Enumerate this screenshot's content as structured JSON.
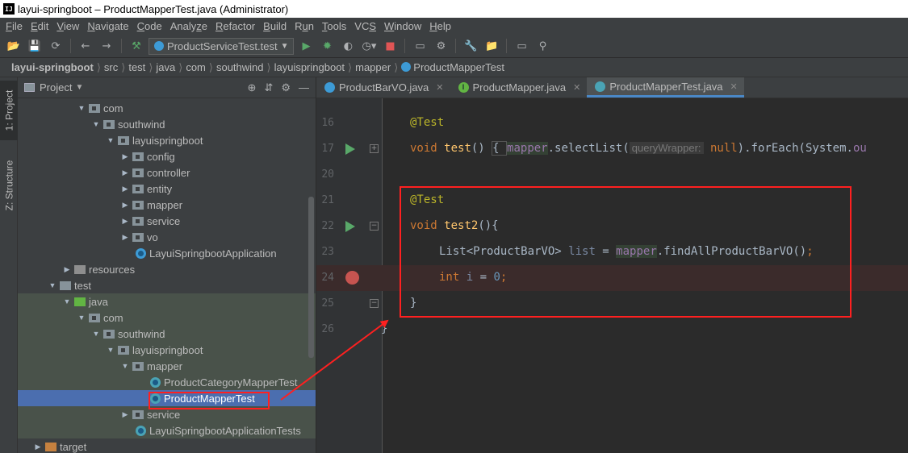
{
  "window": {
    "title": "layui-springboot – ProductMapperTest.java (Administrator)",
    "app_icon": "IJ"
  },
  "menu": {
    "items": [
      {
        "pre": "",
        "u": "F",
        "post": "ile"
      },
      {
        "pre": "",
        "u": "E",
        "post": "dit"
      },
      {
        "pre": "",
        "u": "V",
        "post": "iew"
      },
      {
        "pre": "",
        "u": "N",
        "post": "avigate"
      },
      {
        "pre": "",
        "u": "C",
        "post": "ode"
      },
      {
        "pre": "Analy",
        "u": "z",
        "post": "e"
      },
      {
        "pre": "",
        "u": "R",
        "post": "efactor"
      },
      {
        "pre": "",
        "u": "B",
        "post": "uild"
      },
      {
        "pre": "R",
        "u": "u",
        "post": "n"
      },
      {
        "pre": "",
        "u": "T",
        "post": "ools"
      },
      {
        "pre": "VC",
        "u": "S",
        "post": ""
      },
      {
        "pre": "",
        "u": "W",
        "post": "indow"
      },
      {
        "pre": "",
        "u": "H",
        "post": "elp"
      }
    ]
  },
  "toolbar": {
    "run_config": "ProductServiceTest.test"
  },
  "breadcrumb": {
    "items": [
      "layui-springboot",
      "src",
      "test",
      "java",
      "com",
      "southwind",
      "layuispringboot",
      "mapper",
      "ProductMapperTest"
    ]
  },
  "toolstrip": {
    "project_tab": "1: Project",
    "structure_tab": "Z: Structure"
  },
  "project_panel": {
    "title": "Project",
    "tree": [
      {
        "label": "com"
      },
      {
        "label": "southwind"
      },
      {
        "label": "layuispringboot"
      },
      {
        "label": "config"
      },
      {
        "label": "controller"
      },
      {
        "label": "entity"
      },
      {
        "label": "mapper"
      },
      {
        "label": "service"
      },
      {
        "label": "vo"
      },
      {
        "label": "LayuiSpringbootApplication"
      },
      {
        "label": "resources"
      },
      {
        "label": "test"
      },
      {
        "label": "java"
      },
      {
        "label": "com"
      },
      {
        "label": "southwind"
      },
      {
        "label": "layuispringboot"
      },
      {
        "label": "mapper"
      },
      {
        "label": "ProductCategoryMapperTest"
      },
      {
        "label": "ProductMapperTest"
      },
      {
        "label": "service"
      },
      {
        "label": "LayuiSpringbootApplicationTests"
      },
      {
        "label": "target"
      }
    ]
  },
  "editor": {
    "tabs": [
      {
        "label": "ProductBarVO.java",
        "icon": "class-icon"
      },
      {
        "label": "ProductMapper.java",
        "icon": "interface-icon"
      },
      {
        "label": "ProductMapperTest.java",
        "icon": "test-class-icon",
        "active": true
      }
    ],
    "line_numbers": [
      "16",
      "17",
      "20",
      "21",
      "22",
      "23",
      "24",
      "25",
      "26"
    ],
    "tokens": {
      "l16_anno": "@Test",
      "l17_void": "void ",
      "l17_name": "test",
      "l17_parens": "() ",
      "l17_brace": "{ ",
      "l17_mapper": "mapper",
      "l17_call": ".selectList(",
      "l17_hint": "queryWrapper:",
      "l17_null": " null",
      "l17_rest": ").forEach(System.",
      "l17_tail": "ou",
      "l21_anno": "@Test",
      "l22_void": "void ",
      "l22_name": "test2",
      "l22_rest": "(){",
      "l23_type": "List<ProductBarVO> ",
      "l23_var": "list",
      "l23_eq": " = ",
      "l23_mapper": "mapper",
      "l23_call": ".findAllProductBarVO()",
      "l23_semi": ";",
      "l24_int": "int ",
      "l24_var": "i",
      "l24_eq": " = ",
      "l24_num": "0",
      "l24_semi": ";",
      "l25_close": "}",
      "l26_close": "}"
    }
  },
  "colors": {
    "annotation_box": "#ff2020",
    "selection": "#4b6eaf",
    "breakpoint": "#c75450",
    "run_marker": "#59a869"
  }
}
